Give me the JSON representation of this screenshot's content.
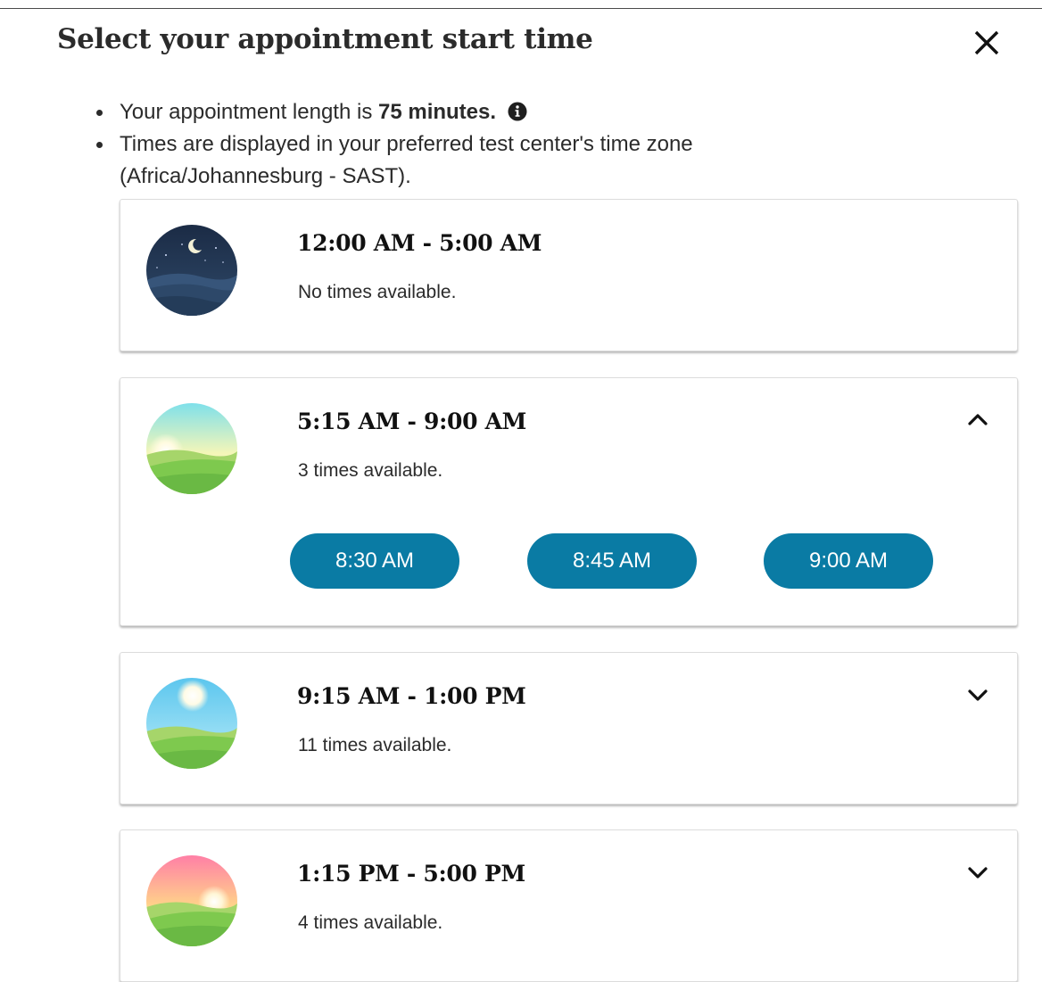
{
  "dialog": {
    "title": "Select your appointment start time",
    "close_icon": "close-icon"
  },
  "info": {
    "length_prefix": "Your appointment length is ",
    "length_value": "75 minutes.",
    "info_icon": "info-circle-icon",
    "timezone_text": "Times are displayed in your preferred test center's time zone (Africa/Johannesburg - SAST)."
  },
  "time_blocks": [
    {
      "range": "12:00 AM - 5:00 AM",
      "availability": "No times available.",
      "image": "night-scene-icon",
      "expandable": false
    },
    {
      "range": "5:15 AM - 9:00 AM",
      "availability": "3 times available.",
      "image": "sunrise-scene-icon",
      "expanded": true,
      "chevron": "chevron-up-icon",
      "slots": [
        "8:30 AM",
        "8:45 AM",
        "9:00 AM"
      ]
    },
    {
      "range": "9:15 AM - 1:00 PM",
      "availability": "11 times available.",
      "image": "midday-scene-icon",
      "expanded": false,
      "chevron": "chevron-down-icon"
    },
    {
      "range": "1:15 PM - 5:00 PM",
      "availability": "4 times available.",
      "image": "sunset-scene-icon",
      "expanded": false,
      "chevron": "chevron-down-icon"
    }
  ],
  "colors": {
    "slot_button": "#0a7ba4",
    "slot_text": "#ffffff",
    "card_border": "#dcdcdc"
  }
}
